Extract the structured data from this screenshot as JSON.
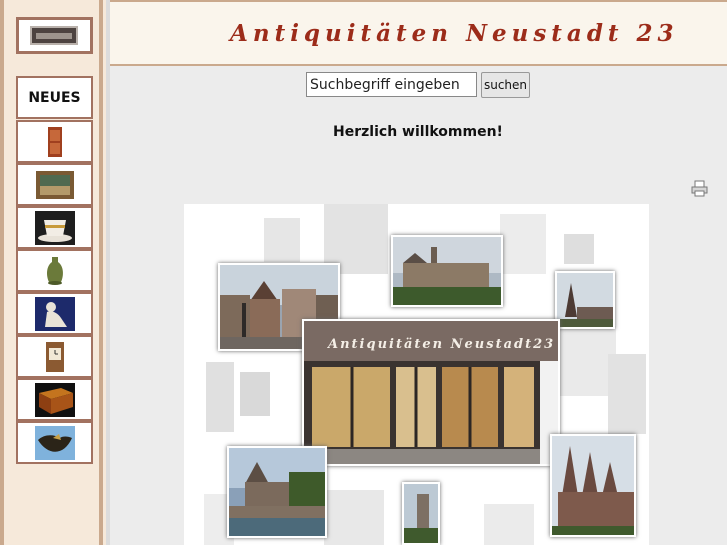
{
  "header": {
    "title": "Antiquitäten Neustadt 23"
  },
  "sidebar": {
    "logo_icon": "shopfront-logo-icon",
    "items": [
      {
        "label": "NEUES"
      },
      {
        "icon": "cabinet-icon"
      },
      {
        "icon": "painting-icon"
      },
      {
        "icon": "cup-icon"
      },
      {
        "icon": "vase-icon"
      },
      {
        "icon": "figurine-icon"
      },
      {
        "icon": "clock-icon"
      },
      {
        "icon": "box-icon"
      },
      {
        "icon": "bowl-icon"
      }
    ]
  },
  "search": {
    "placeholder": "Suchbegriff eingeben",
    "button_label": "suchen"
  },
  "main": {
    "welcome": "Herzlich willkommen!",
    "collage_sign": "Antiquitäten Neustadt23",
    "print_icon": "print-icon"
  },
  "colors": {
    "accent": "#9c2c1a",
    "border": "#a27260",
    "sidebar_bg": "#f6e9da",
    "header_bg": "#faf5ec"
  }
}
